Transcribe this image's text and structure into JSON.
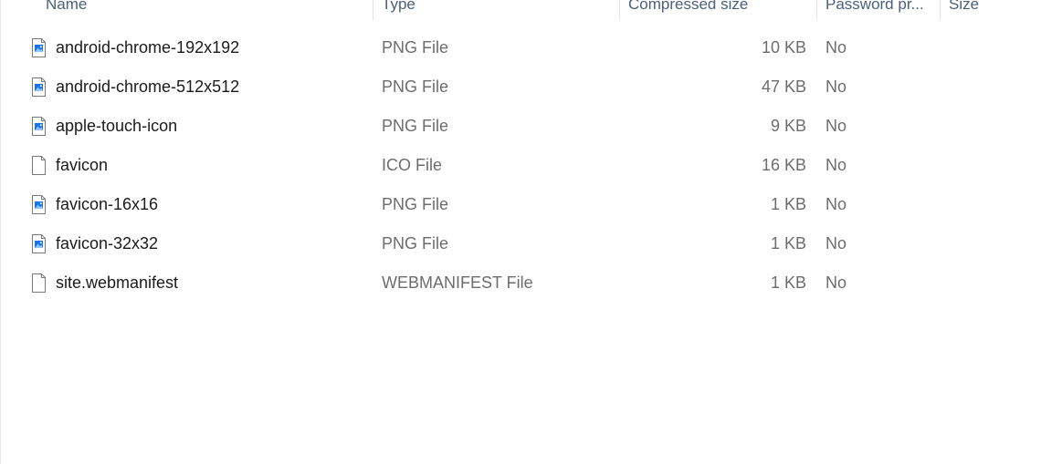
{
  "columns": {
    "name": "Name",
    "type": "Type",
    "compressed_size": "Compressed size",
    "password": "Password pr...",
    "size": "Size"
  },
  "files": [
    {
      "name": "android-chrome-192x192",
      "type": "PNG File",
      "compressed_size": "10 KB",
      "password": "No",
      "icon": "png-image-icon"
    },
    {
      "name": "android-chrome-512x512",
      "type": "PNG File",
      "compressed_size": "47 KB",
      "password": "No",
      "icon": "png-image-icon"
    },
    {
      "name": "apple-touch-icon",
      "type": "PNG File",
      "compressed_size": "9 KB",
      "password": "No",
      "icon": "png-image-icon"
    },
    {
      "name": "favicon",
      "type": "ICO File",
      "compressed_size": "16 KB",
      "password": "No",
      "icon": "blank-file-icon"
    },
    {
      "name": "favicon-16x16",
      "type": "PNG File",
      "compressed_size": "1 KB",
      "password": "No",
      "icon": "png-image-icon"
    },
    {
      "name": "favicon-32x32",
      "type": "PNG File",
      "compressed_size": "1 KB",
      "password": "No",
      "icon": "png-image-icon"
    },
    {
      "name": "site.webmanifest",
      "type": "WEBMANIFEST File",
      "compressed_size": "1 KB",
      "password": "No",
      "icon": "blank-file-icon"
    }
  ],
  "colors": {
    "header_text": "#4c607a",
    "name_text": "#1b1b1b",
    "detail_text": "#6d6d6d",
    "image_icon_accent": "#1a73e8"
  }
}
